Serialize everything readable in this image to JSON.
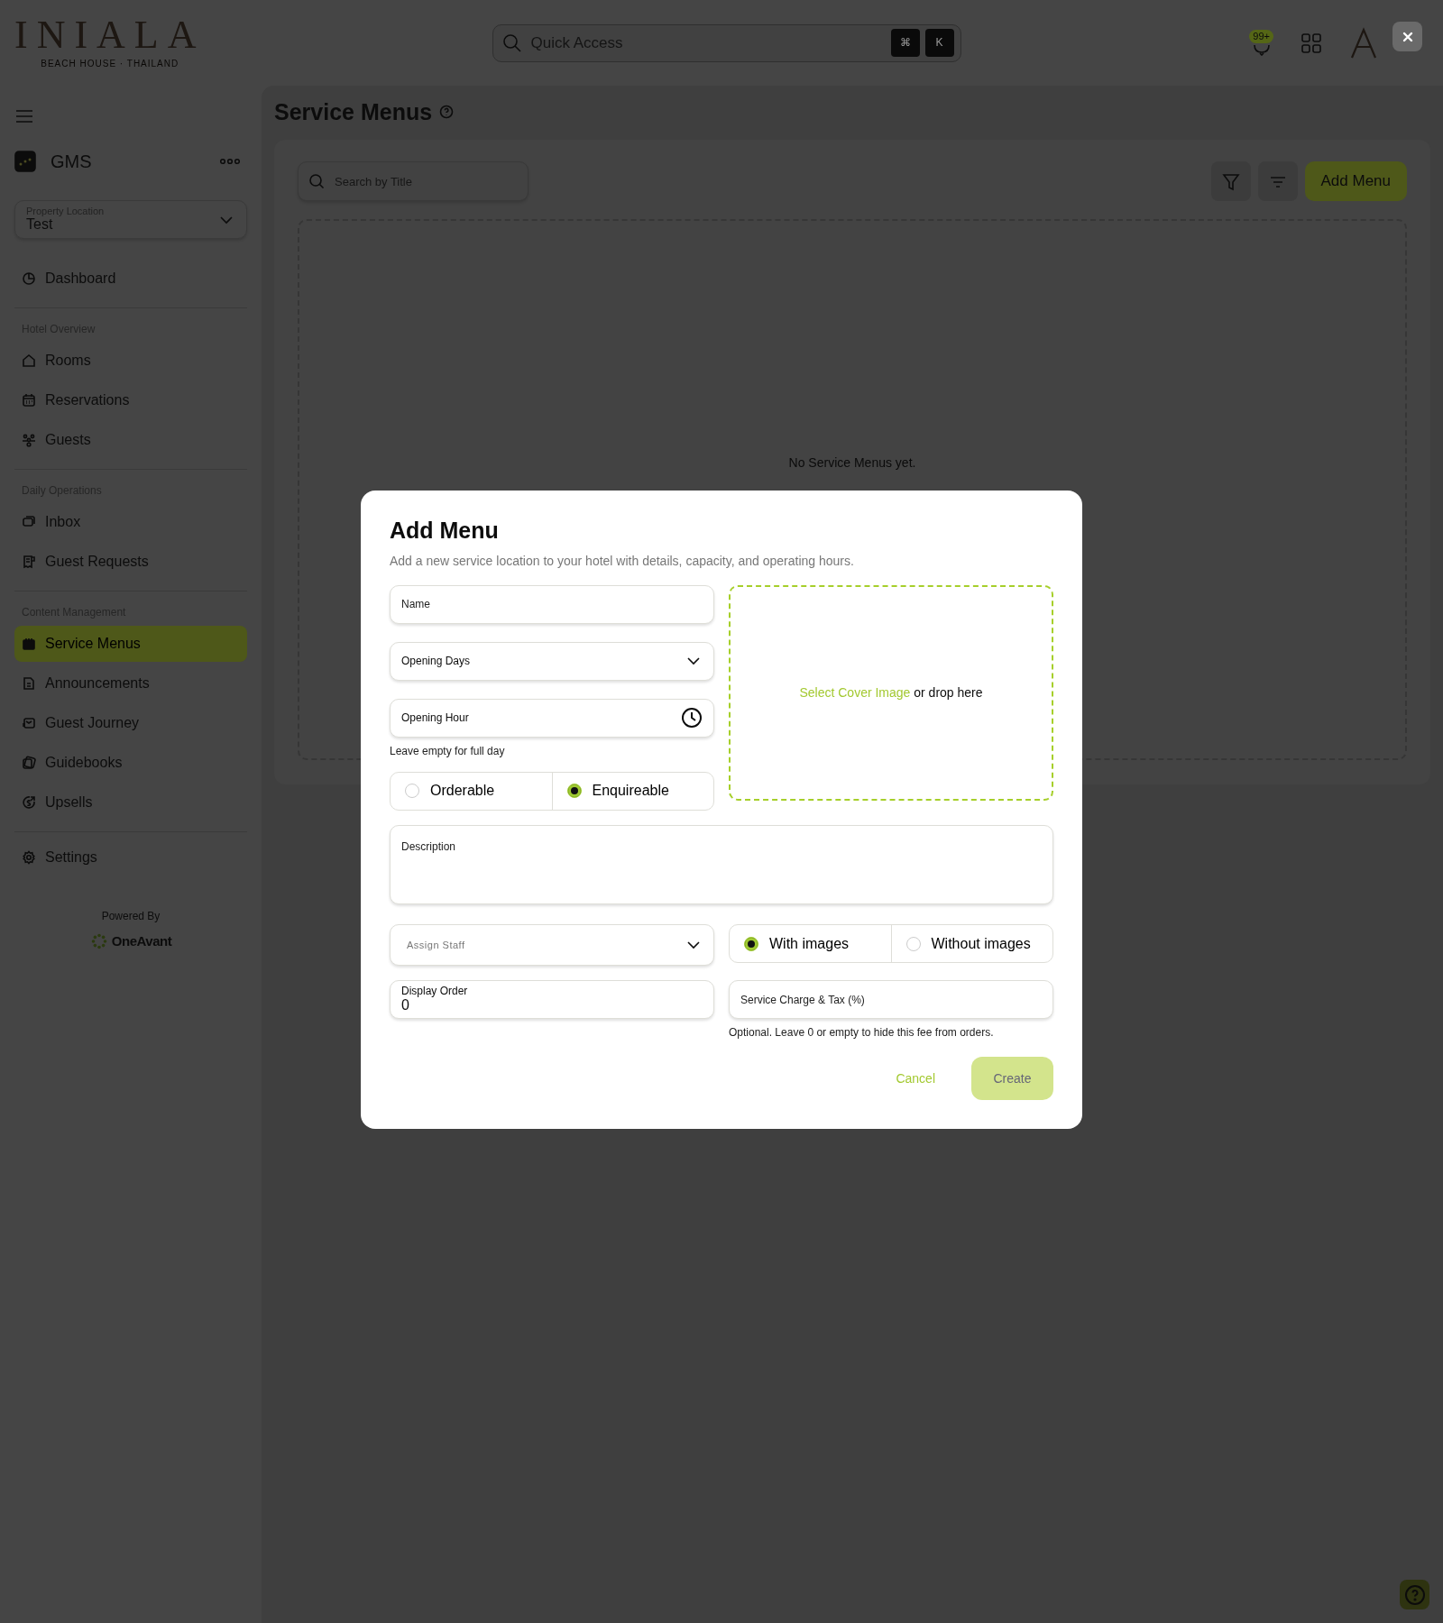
{
  "header": {
    "logo": {
      "title": "INIALA",
      "subtitle": "BEACH HOUSE · THAILAND"
    },
    "search": {
      "placeholder": "Quick Access",
      "keys": [
        "⌘",
        "K"
      ]
    },
    "notification_count": "99+"
  },
  "sidebar": {
    "app": "GMS",
    "property_location": {
      "label": "Property Location",
      "value": "Test"
    },
    "sections": [
      {
        "items": [
          {
            "label": "Dashboard",
            "selected": false
          }
        ]
      },
      {
        "heading": "Hotel Overview",
        "items": [
          {
            "label": "Rooms",
            "selected": false
          },
          {
            "label": "Reservations",
            "selected": false
          },
          {
            "label": "Guests",
            "selected": false
          }
        ]
      },
      {
        "heading": "Daily Operations",
        "items": [
          {
            "label": "Inbox",
            "selected": false
          },
          {
            "label": "Guest Requests",
            "selected": false
          }
        ]
      },
      {
        "heading": "Content Management",
        "items": [
          {
            "label": "Service Menus",
            "selected": true
          },
          {
            "label": "Announcements",
            "selected": false
          },
          {
            "label": "Guest Journey",
            "selected": false
          },
          {
            "label": "Guidebooks",
            "selected": false
          },
          {
            "label": "Upsells",
            "selected": false
          }
        ]
      },
      {
        "items": [
          {
            "label": "Settings",
            "selected": false
          }
        ]
      }
    ],
    "powered_by": "Powered By",
    "brand": "OneAvant"
  },
  "main": {
    "title": "Service Menus",
    "search": {
      "placeholder": "Search by Title"
    },
    "add_button": "Add Menu",
    "empty_text": "No Service Menus yet."
  },
  "modal": {
    "title": "Add Menu",
    "subtitle": "Add a new service location to your hotel with details, capacity, and operating hours.",
    "name": {
      "placeholder": "Name"
    },
    "opening_days": {
      "placeholder": "Opening Days"
    },
    "opening_hour": {
      "placeholder": "Opening Hour",
      "hint": "Leave empty for full day"
    },
    "menu_type": [
      {
        "label": "Orderable",
        "selected": false
      },
      {
        "label": "Enquireable",
        "selected": true
      }
    ],
    "cover": {
      "link": "Select Cover Image",
      "text": "or drop here"
    },
    "description": {
      "placeholder": "Description"
    },
    "assign_staff": {
      "placeholder": "Assign Staff"
    },
    "image_mode": [
      {
        "label": "With images",
        "selected": true
      },
      {
        "label": "Without images",
        "selected": false
      }
    ],
    "display_order": {
      "label": "Display Order",
      "value": "0"
    },
    "service_charge": {
      "placeholder": "Service Charge & Tax (%)",
      "hint": "Optional. Leave 0 or empty to hide this fee from orders."
    },
    "cancel": "Cancel",
    "create": {
      "label": "Create",
      "disabled": true
    }
  }
}
